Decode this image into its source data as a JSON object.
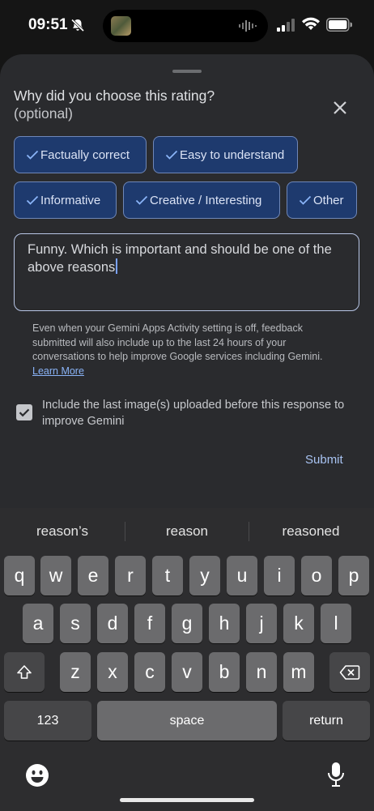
{
  "status_bar": {
    "time": "09:51"
  },
  "sheet": {
    "title": "Why did you choose this rating?",
    "subtitle": "(optional)",
    "chips": [
      {
        "label": "Factually correct"
      },
      {
        "label": "Easy to understand"
      },
      {
        "label": "Informative"
      },
      {
        "label": "Creative / Interesting"
      },
      {
        "label": "Other"
      }
    ],
    "feedback_text": "Funny. Which is important and should be one of the above reasons",
    "disclaimer": "Even when your Gemini Apps Activity setting is off, feedback submitted will also include up to the last 24 hours of your conversations to help improve Google services including Gemini.",
    "learn_more": "Learn More",
    "checkbox_label": "Include the last image(s) uploaded before this response to improve Gemini",
    "submit": "Submit"
  },
  "keyboard": {
    "suggestions": [
      "reason’s",
      "reason",
      "reasoned"
    ],
    "row1": [
      "q",
      "w",
      "e",
      "r",
      "t",
      "y",
      "u",
      "i",
      "o",
      "p"
    ],
    "row2": [
      "a",
      "s",
      "d",
      "f",
      "g",
      "h",
      "j",
      "k",
      "l"
    ],
    "row3": [
      "z",
      "x",
      "c",
      "v",
      "b",
      "n",
      "m"
    ],
    "numbers": "123",
    "space": "space",
    "return": "return"
  }
}
